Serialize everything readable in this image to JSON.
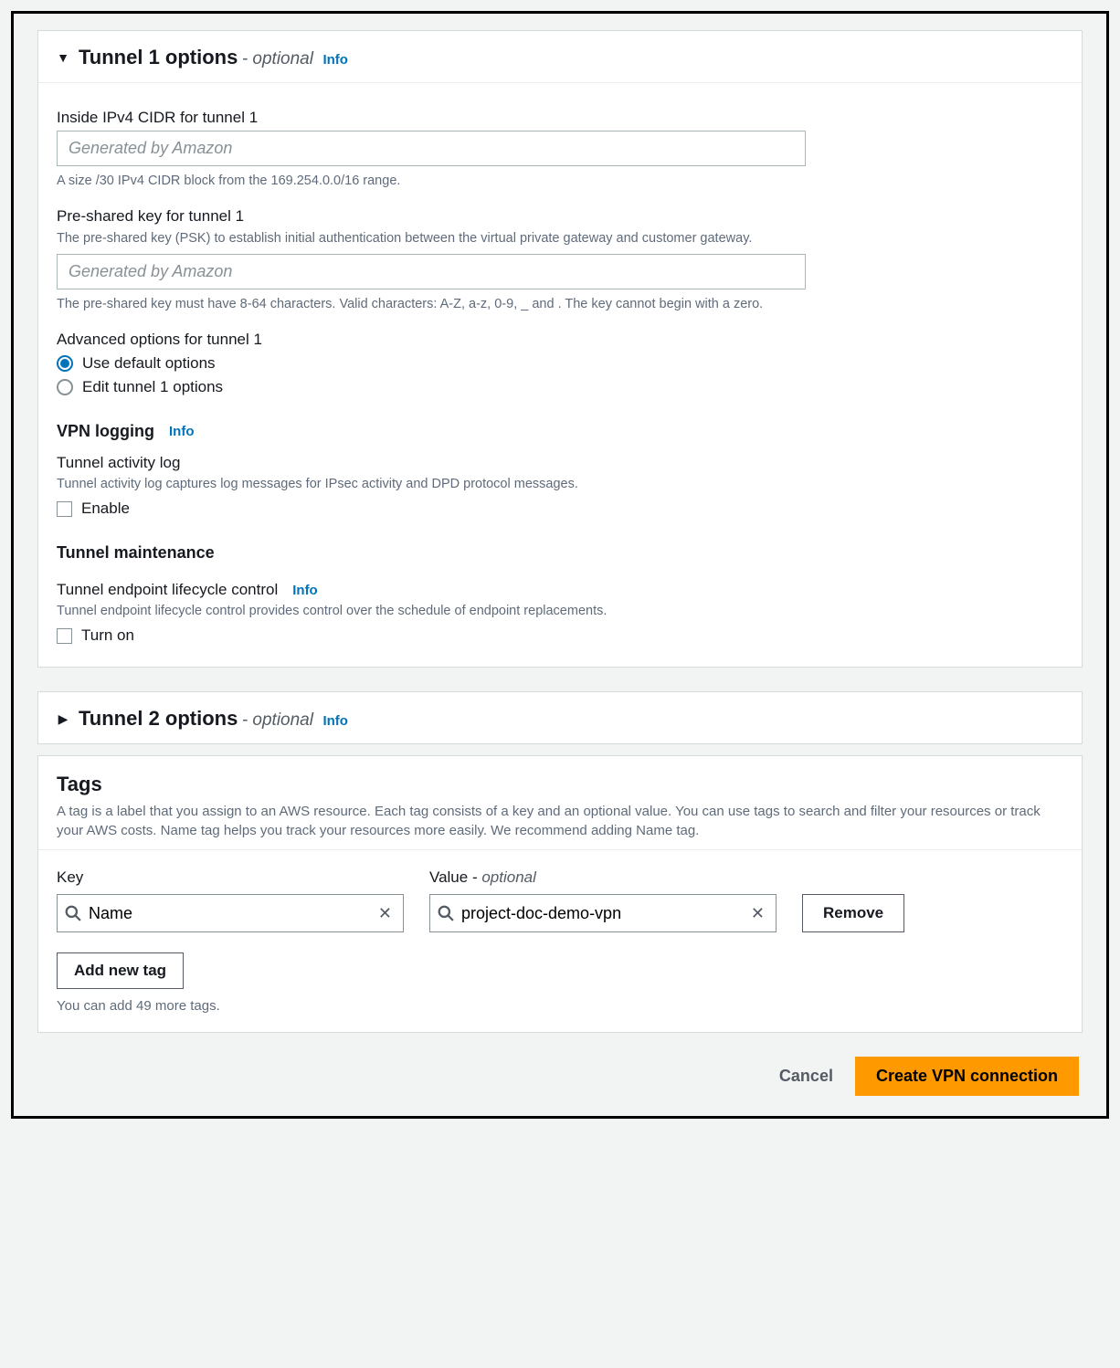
{
  "tunnel1": {
    "title": "Tunnel 1 options",
    "optional_suffix": "- optional",
    "info": "Info",
    "ipv4": {
      "label": "Inside IPv4 CIDR for tunnel 1",
      "placeholder": "Generated by Amazon",
      "value": "",
      "help": "A size /30 IPv4 CIDR block from the 169.254.0.0/16 range."
    },
    "psk": {
      "label": "Pre-shared key for tunnel 1",
      "sublabel": "The pre-shared key (PSK) to establish initial authentication between the virtual private gateway and customer gateway.",
      "placeholder": "Generated by Amazon",
      "value": "",
      "help": "The pre-shared key must have 8-64 characters. Valid characters: A-Z, a-z, 0-9, _ and . The key cannot begin with a zero."
    },
    "advanced": {
      "label": "Advanced options for tunnel 1",
      "options": [
        {
          "label": "Use default options",
          "checked": true
        },
        {
          "label": "Edit tunnel 1 options",
          "checked": false
        }
      ]
    },
    "vpn_logging": {
      "heading": "VPN logging",
      "info": "Info",
      "activity_label": "Tunnel activity log",
      "activity_help": "Tunnel activity log captures log messages for IPsec activity and DPD protocol messages.",
      "enable_label": "Enable",
      "enable_checked": false
    },
    "maintenance": {
      "heading": "Tunnel maintenance",
      "lifecycle_label": "Tunnel endpoint lifecycle control",
      "info": "Info",
      "lifecycle_help": "Tunnel endpoint lifecycle control provides control over the schedule of endpoint replacements.",
      "turn_on_label": "Turn on",
      "turn_on_checked": false
    }
  },
  "tunnel2": {
    "title": "Tunnel 2 options",
    "optional_suffix": "- optional",
    "info": "Info"
  },
  "tags": {
    "title": "Tags",
    "description": "A tag is a label that you assign to an AWS resource. Each tag consists of a key and an optional value. You can use tags to search and filter your resources or track your AWS costs. Name tag helps you track your resources more easily. We recommend adding Name tag.",
    "key_label": "Key",
    "value_label_prefix": "Value - ",
    "value_label_optional": "optional",
    "row": {
      "key": "Name",
      "value": "project-doc-demo-vpn"
    },
    "remove_label": "Remove",
    "add_new_label": "Add new tag",
    "remaining": "You can add 49 more tags."
  },
  "footer": {
    "cancel": "Cancel",
    "create": "Create VPN connection"
  }
}
